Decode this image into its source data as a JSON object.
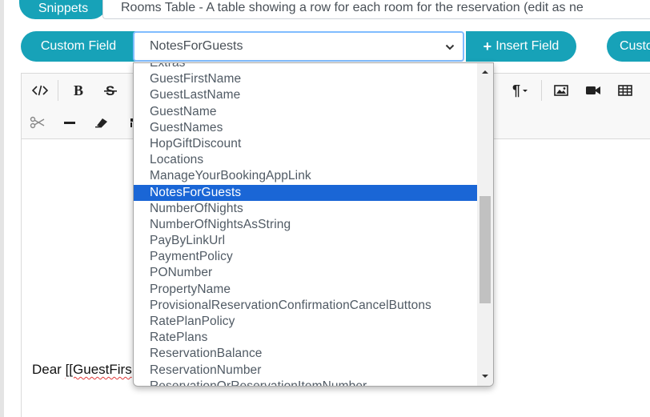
{
  "snippets": {
    "button_label": "Snippets",
    "selected_value": "Rooms Table - A table showing a row for each room for the reservation (edit as ne"
  },
  "custom_field": {
    "button_label": "Custom Field",
    "selected_value": "NotesForGuests",
    "insert_label": "Insert Field",
    "second_button_label": "Custo"
  },
  "toolbar": {
    "paragraph_glyph": "¶"
  },
  "editor": {
    "body_prefix": "Dear ",
    "body_squiggle": "[[GuestFirs"
  },
  "dropdown": {
    "options": [
      "Extras",
      "GuestFirstName",
      "GuestLastName",
      "GuestName",
      "GuestNames",
      "HopGiftDiscount",
      "Locations",
      "ManageYourBookingAppLink",
      "NotesForGuests",
      "NumberOfNights",
      "NumberOfNightsAsString",
      "PayByLinkUrl",
      "PaymentPolicy",
      "PONumber",
      "PropertyName",
      "ProvisionalReservationConfirmationCancelButtons",
      "RatePlanPolicy",
      "RatePlans",
      "ReservationBalance",
      "ReservationNumber",
      "ReservationOrReservationItemNumber"
    ],
    "selected_index": 8
  },
  "colors": {
    "accent": "#17a2b8",
    "selection": "#1a66d6"
  }
}
